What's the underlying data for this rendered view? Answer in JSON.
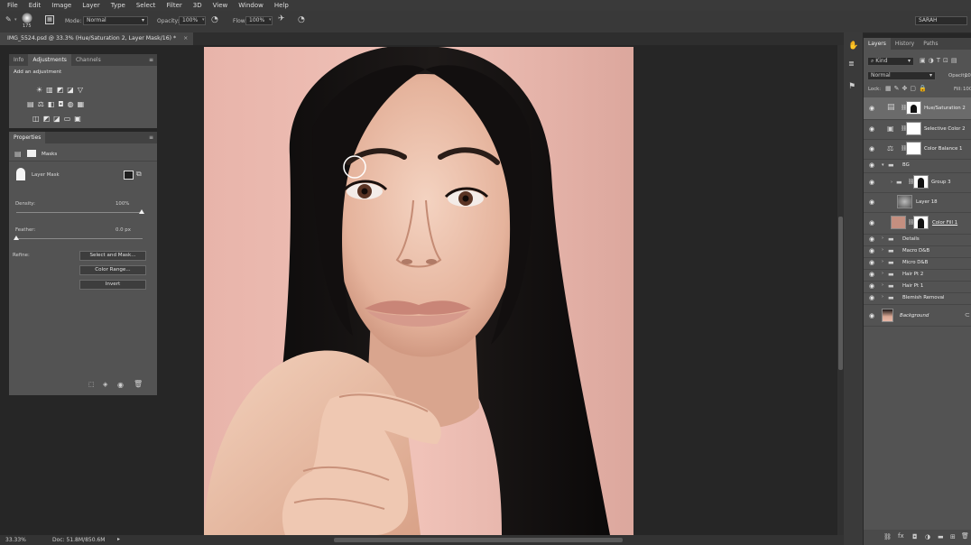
{
  "menu": [
    "File",
    "Edit",
    "Image",
    "Layer",
    "Type",
    "Select",
    "Filter",
    "3D",
    "View",
    "Window",
    "Help"
  ],
  "options_bar": {
    "brush_size": "175",
    "mode_label": "Mode:",
    "mode_value": "Normal",
    "opacity_label": "Opacity:",
    "opacity_value": "100%",
    "flow_label": "Flow:",
    "flow_value": "100%",
    "workspace": "SARAH"
  },
  "document": {
    "tab_title": "IMG_5524.psd @ 33.3% (Hue/Saturation 2, Layer Mask/16) *",
    "close_symbol": "×",
    "zoom": "33.33%",
    "doc_info": "Doc: 51.8M/850.6M"
  },
  "info_panel": {
    "tabs": [
      "Info",
      "Adjustments",
      "Channels"
    ],
    "active_tab": "Adjustments",
    "heading": "Add an adjustment"
  },
  "properties": {
    "title": "Properties",
    "section": "Masks",
    "mask_type": "Layer Mask",
    "density_label": "Density:",
    "density_value": "100%",
    "density_level": 1.0,
    "feather_label": "Feather:",
    "feather_value": "0.0 px",
    "feather_level": 0.0,
    "refine_label": "Refine:",
    "buttons": [
      "Select and Mask...",
      "Color Range...",
      "Invert"
    ]
  },
  "layers_panel": {
    "tabs": [
      "Layers",
      "History",
      "Paths"
    ],
    "active_tab": "Layers",
    "filter_kind": "Kind",
    "blend_mode": "Normal",
    "opacity_label": "Opacity:",
    "opacity_value": "100",
    "lock_label": "Lock:",
    "fill_label": "Fill:",
    "fill_value": "100",
    "layers": [
      {
        "name": "Hue/Saturation 2",
        "type": "adjustment",
        "selected": true
      },
      {
        "name": "Selective Color 2",
        "type": "adjustment"
      },
      {
        "name": "Color Balance 1",
        "type": "adjustment"
      },
      {
        "name": "BG",
        "type": "group-open"
      },
      {
        "name": "Group 3",
        "type": "group"
      },
      {
        "name": "Layer 18",
        "type": "pixel"
      },
      {
        "name": "Color Fill 1",
        "type": "fill"
      },
      {
        "name": "Details",
        "type": "group"
      },
      {
        "name": "Macro D&B",
        "type": "group"
      },
      {
        "name": "Micro D&B",
        "type": "group"
      },
      {
        "name": "Hair Pt 2",
        "type": "group"
      },
      {
        "name": "Hair Pt 1",
        "type": "group"
      },
      {
        "name": "Blemish Removal",
        "type": "group"
      },
      {
        "name": "Background",
        "type": "background"
      }
    ],
    "fx_label": "fx"
  },
  "colors": {
    "accent_selected": "#6b6b6b",
    "panel_bg": "#535353",
    "app_bg": "#262626",
    "photo_bg": "#e0ada4"
  }
}
